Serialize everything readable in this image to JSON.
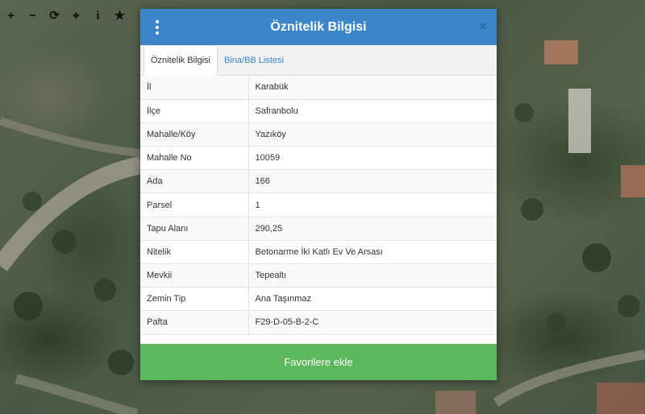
{
  "toolbar": {
    "tools": [
      {
        "name": "zoom-in-tool",
        "glyph": "+"
      },
      {
        "name": "zoom-out-tool",
        "glyph": "−"
      },
      {
        "name": "refresh-tool",
        "glyph": "⟳"
      },
      {
        "name": "locate-tool",
        "glyph": "⌖"
      },
      {
        "name": "info-tool",
        "glyph": "i"
      },
      {
        "name": "favorites-tool",
        "glyph": "★"
      }
    ]
  },
  "dialog": {
    "title": "Öznitelik Bilgisi",
    "close_glyph": "×",
    "tabs": [
      {
        "label": "Öznitelik Bilgisi",
        "active": true
      },
      {
        "label": "Bina/BB Listesi",
        "active": false
      }
    ],
    "rows": [
      {
        "key": "İl",
        "value": "Karabük"
      },
      {
        "key": "İlçe",
        "value": "Safranbolu"
      },
      {
        "key": "Mahalle/Köy",
        "value": "Yazıköy"
      },
      {
        "key": "Mahalle No",
        "value": "10059"
      },
      {
        "key": "Ada",
        "value": "166"
      },
      {
        "key": "Parsel",
        "value": "1"
      },
      {
        "key": "Tapu Alanı",
        "value": "290,25"
      },
      {
        "key": "Nitelik",
        "value": "Betonarme İki Katlı Ev Ve Arsası"
      },
      {
        "key": "Mevkii",
        "value": "Tepealtı"
      },
      {
        "key": "Zemin Tip",
        "value": "Ana Taşınmaz"
      },
      {
        "key": "Pafta",
        "value": "F29-D-05-B-2-C"
      }
    ],
    "favorite_button": "Favorilere ekle"
  }
}
